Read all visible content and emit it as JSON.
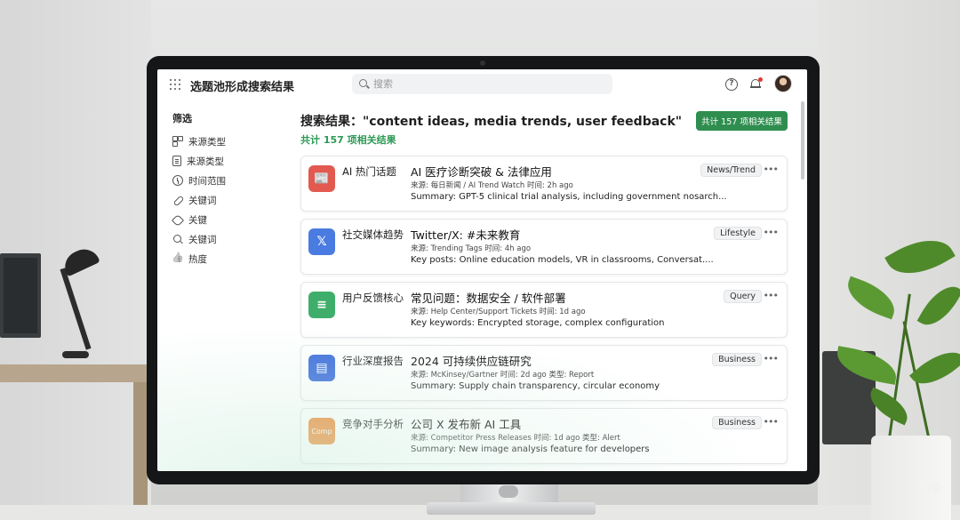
{
  "app": {
    "title": "选题池形成搜索结果"
  },
  "search": {
    "placeholder": "搜索"
  },
  "sidebar": {
    "title": "筛选",
    "items": [
      {
        "label": "来源类型",
        "icon": "grid-icon"
      },
      {
        "label": "来源类型",
        "icon": "document-icon"
      },
      {
        "label": "时间范围",
        "icon": "clock-icon"
      },
      {
        "label": "关键词",
        "icon": "link-icon"
      },
      {
        "label": "关键",
        "icon": "tag-icon"
      },
      {
        "label": "关键词",
        "icon": "search-icon"
      },
      {
        "label": "热度",
        "icon": "thumbs-up-icon"
      }
    ]
  },
  "results": {
    "title": "搜索结果：\"content ideas, media trends, user feedback\"",
    "count_text": "共计 157 项相关结果",
    "count_button": "共计 157 项相关结果"
  },
  "cards": [
    {
      "category": "AI 热门话题",
      "headline": "AI 医疗诊断突破 & 法律应用",
      "meta": "来源: 每日新闻 / AI Trend Watch   时间: 2h ago",
      "summary": "Summary: GPT-5 clinical trial analysis, including government nosarch...",
      "tag": "News/Trend",
      "icon_glyph": "📰",
      "icon_color": "#e25a4f"
    },
    {
      "category": "社交媒体趋势",
      "headline": "Twitter/X: #未来教育",
      "meta": "来源: Trending Tags   时间: 4h ago",
      "summary": "Key posts: Online education models, VR in classrooms, Conversat....",
      "tag": "Lifestyle",
      "icon_glyph": "𝕏",
      "icon_color": "#4a7be0"
    },
    {
      "category": "用户反馈核心",
      "headline": "常见问题：数据安全 / 软件部署",
      "meta": "来源: Help Center/Support Tickets   时间: 1d ago",
      "summary": "Key keywords: Encrypted storage, complex configuration",
      "tag": "Query",
      "icon_glyph": "≡",
      "icon_color": "#3fae6a"
    },
    {
      "category": "行业深度报告",
      "headline": "2024 可持续供应链研究",
      "meta": "来源: McKinsey/Gartner   时间: 2d ago   类型: Report",
      "summary": "Summary: Supply chain transparency, circular economy",
      "tag": "Business",
      "icon_glyph": "▤",
      "icon_color": "#3f6fdc"
    },
    {
      "category": "竞争对手分析",
      "headline": "公司 X 发布新 AI 工具",
      "meta": "来源: Competitor Press Releases   时间: 1d ago   类型: Alert",
      "summary": "Summary: New image analysis feature for developers",
      "tag": "Business",
      "icon_glyph": "Comp",
      "icon_color": "#ef8c3a"
    }
  ]
}
